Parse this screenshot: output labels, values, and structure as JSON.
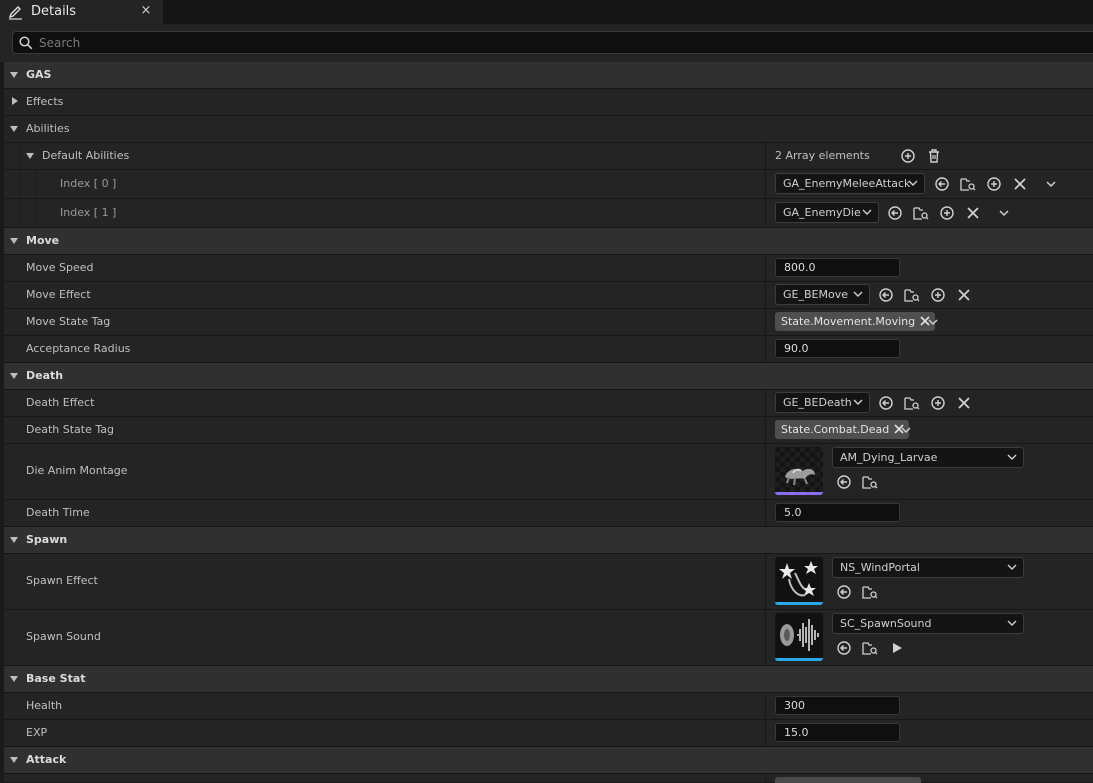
{
  "tab": {
    "title": "Details",
    "close": "×"
  },
  "search": {
    "placeholder": "Search"
  },
  "colors": {
    "accent_mesh": "#8a6cf0",
    "accent_fx": "#2aa8e8"
  },
  "gas": {
    "label": "GAS",
    "effects_label": "Effects",
    "abilities_label": "Abilities",
    "default_abilities": {
      "label": "Default Abilities",
      "count": "2 Array elements"
    },
    "items": [
      {
        "index": "Index [ 0 ]",
        "value": "GA_EnemyMeleeAttack"
      },
      {
        "index": "Index [ 1 ]",
        "value": "GA_EnemyDie"
      }
    ]
  },
  "move": {
    "label": "Move",
    "speed_label": "Move Speed",
    "speed": "800.0",
    "effect_label": "Move Effect",
    "effect": "GE_BEMove",
    "tag_label": "Move State Tag",
    "tag": "State.Movement.Moving",
    "radius_label": "Acceptance Radius",
    "radius": "90.0"
  },
  "death": {
    "label": "Death",
    "effect_label": "Death Effect",
    "effect": "GE_BEDeath",
    "tag_label": "Death State Tag",
    "tag": "State.Combat.Dead",
    "montage_label": "Die Anim Montage",
    "montage": "AM_Dying_Larvae",
    "time_label": "Death Time",
    "time": "5.0"
  },
  "spawn": {
    "label": "Spawn",
    "effect_label": "Spawn Effect",
    "effect": "NS_WindPortal",
    "sound_label": "Spawn Sound",
    "sound": "SC_SpawnSound"
  },
  "base_stat": {
    "label": "Base Stat",
    "health_label": "Health",
    "health": "300",
    "exp_label": "EXP",
    "exp": "15.0"
  },
  "attack": {
    "label": "Attack"
  }
}
